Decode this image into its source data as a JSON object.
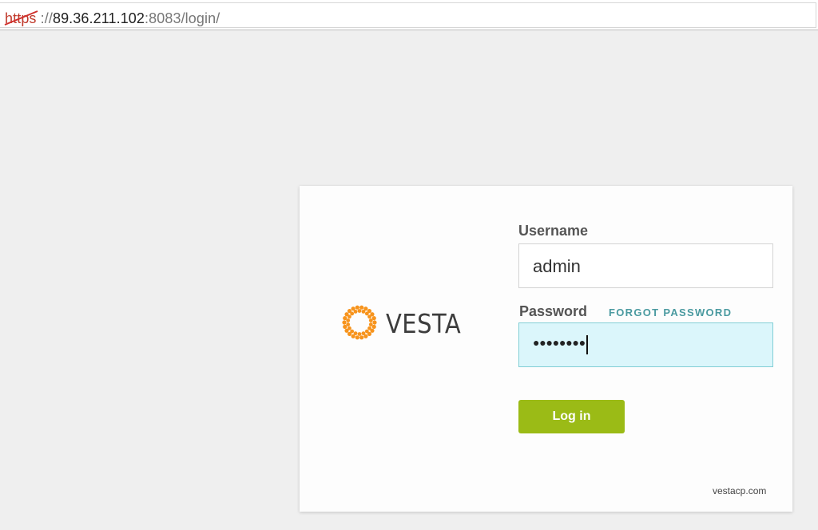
{
  "browser": {
    "url_scheme": "https",
    "url_separator": "://",
    "url_host": "89.36.211.102",
    "url_rest": ":8083/login/"
  },
  "brand": {
    "name": "VESTA",
    "icon": "vesta-logo-icon",
    "accent": "#f7941d"
  },
  "form": {
    "username_label": "Username",
    "username_value": "admin",
    "password_label": "Password",
    "password_mask": "●●●●●●●●",
    "forgot_label": "FORGOT PASSWORD",
    "submit_label": "Log in",
    "submit_color": "#9bbb16"
  },
  "footer": {
    "link": "vestacp.com"
  }
}
